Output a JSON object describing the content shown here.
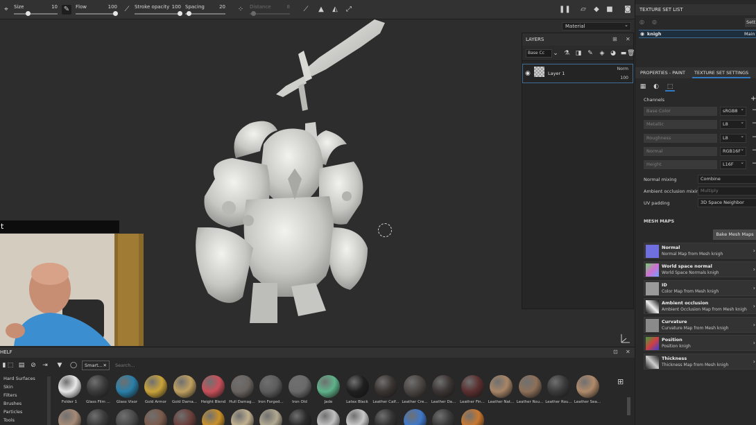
{
  "toolbar": {
    "size_label": "Size",
    "size_value": "10",
    "flow_label": "Flow",
    "flow_value": "100",
    "stroke_opacity_label": "Stroke opacity",
    "stroke_opacity_value": "100",
    "spacing_label": "Spacing",
    "spacing_value": "20",
    "distance_label": "Distance",
    "distance_value": "8"
  },
  "viewport": {
    "material_mode": "Material"
  },
  "webcam": {
    "caption": "t"
  },
  "layers": {
    "title": "LAYERS",
    "channel_select": "Base Cc",
    "layer": {
      "name": "Layer 1",
      "blend_mode": "Norm",
      "opacity": "100"
    }
  },
  "texture_set_list": {
    "title": "TEXTURE SET LIST",
    "settings_button": "Sett",
    "item_name": "knigh",
    "item_shader": "Main"
  },
  "properties": {
    "tab_paint": "PROPERTIES - PAINT",
    "tab_texture_set": "TEXTURE SET SETTINGS",
    "channels_label": "Channels",
    "channels": [
      {
        "name": "Base Color",
        "format": "sRGB8"
      },
      {
        "name": "Metallic",
        "format": "L8"
      },
      {
        "name": "Roughness",
        "format": "L8"
      },
      {
        "name": "Normal",
        "format": "RGB16F"
      },
      {
        "name": "Height",
        "format": "L16F"
      }
    ],
    "normal_mixing_label": "Normal mixing",
    "normal_mixing_value": "Combine",
    "ao_mixing_label": "Ambient occlusion mixing",
    "ao_mixing_value": "Multiply",
    "uv_padding_label": "UV padding",
    "uv_padding_value": "3D Space Neighbor",
    "mesh_maps_label": "MESH MAPS",
    "bake_button": "Bake Mesh Maps",
    "mesh_maps": [
      {
        "title": "Normal",
        "sub": "Normal Map from Mesh knigh"
      },
      {
        "title": "World space normal",
        "sub": "World Space Normals knigh"
      },
      {
        "title": "ID",
        "sub": "Color Map from Mesh knigh"
      },
      {
        "title": "Ambient occlusion",
        "sub": "Ambient Occlusion Map from Mesh knigh"
      },
      {
        "title": "Curvature",
        "sub": "Curvature Map from Mesh knigh"
      },
      {
        "title": "Position",
        "sub": "Position knigh"
      },
      {
        "title": "Thickness",
        "sub": "Thickness Map from Mesh knigh"
      }
    ]
  },
  "shelf": {
    "title": "HELF",
    "filter_chip": "Smart...",
    "search_placeholder": "Search...",
    "categories": [
      "Hard Surfaces",
      "Skin",
      "Filters",
      "Brushes",
      "Particles",
      "Tools"
    ],
    "materials": [
      {
        "name": "Folder 1",
        "color": "#e8e8e8"
      },
      {
        "name": "Glass Film ...",
        "color": "#3a3a3a"
      },
      {
        "name": "Glass Visor",
        "color": "#2a7fa8"
      },
      {
        "name": "Gold Armor",
        "color": "#c9a33a"
      },
      {
        "name": "Gold Dama...",
        "color": "#bfa060"
      },
      {
        "name": "Height Blend",
        "color": "#c8505a"
      },
      {
        "name": "Hull Damag...",
        "color": "#6a6460"
      },
      {
        "name": "Iron Forged...",
        "color": "#5c5c5c"
      },
      {
        "name": "Iron Old",
        "color": "#6a6a6a"
      },
      {
        "name": "Jade",
        "color": "#5fb38a"
      },
      {
        "name": "Latex Black",
        "color": "#1f1f1f"
      },
      {
        "name": "Leather Calf...",
        "color": "#3a3431"
      },
      {
        "name": "Leather Cre...",
        "color": "#4a4542"
      },
      {
        "name": "Leather Da...",
        "color": "#3b3533"
      },
      {
        "name": "Leather Fin...",
        "color": "#5a2f2f"
      },
      {
        "name": "Leather Nat...",
        "color": "#a88566"
      },
      {
        "name": "Leather Rou...",
        "color": "#8d7059"
      },
      {
        "name": "Leather Rou...",
        "color": "#3a3a3a"
      },
      {
        "name": "Leather Sea...",
        "color": "#b08a6a"
      }
    ],
    "materials_row2": [
      "#a58a76",
      "#3a3a3a",
      "#4a4a4a",
      "#7a5a4a",
      "#6a3f3a",
      "#c8902a",
      "#c0b090",
      "#b0a890",
      "#2a2a2a",
      "#c0c0c0",
      "#c8c8c8",
      "#333",
      "#3f77c8",
      "#3a3a3a",
      "#c87830"
    ]
  }
}
